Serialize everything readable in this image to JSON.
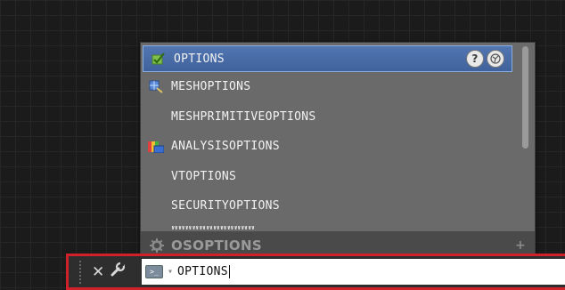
{
  "autocomplete": {
    "items": [
      {
        "label": "OPTIONS",
        "icon": "check-icon",
        "selected": true
      },
      {
        "label": "MESHOPTIONS",
        "icon": "mesh-icon"
      },
      {
        "label": "MESHPRIMITIVEOPTIONS",
        "icon": ""
      },
      {
        "label": "ANALYSISOPTIONS",
        "icon": "analysis-icon"
      },
      {
        "label": "VTOPTIONS",
        "icon": ""
      },
      {
        "label": "SECURITYOPTIONS",
        "icon": ""
      }
    ],
    "help_glyph": "?",
    "footer": {
      "label": "OSOPTIONS",
      "icon": "gear-icon",
      "plus": "+"
    }
  },
  "command_line": {
    "close_glyph": "✕",
    "customize_icon": "wrench-icon",
    "prompt_icon": "command-prompt-icon",
    "input_value": "OPTIONS"
  },
  "colors": {
    "selected_item": "#4a6ea9",
    "highlight_border": "#d0202a"
  }
}
